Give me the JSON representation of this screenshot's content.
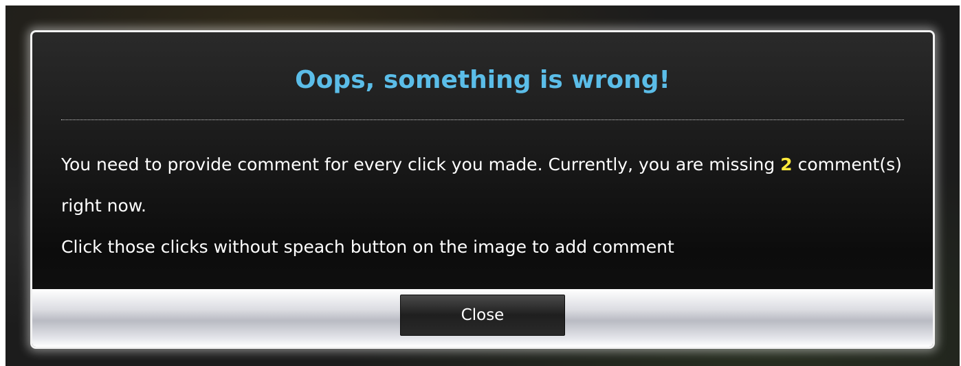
{
  "dialog": {
    "title": "Oops, something is wrong!",
    "message_part1": "You need to provide comment for every click you made. Currently, you are missing ",
    "missing_count": "2",
    "message_part2": " comment(s) right now.",
    "instruction": "Click those clicks without speach button on the image to add comment",
    "close_label": "Close"
  },
  "colors": {
    "title": "#5bbde8",
    "highlight": "#ffeb3b",
    "dialog_background": "#111111",
    "footer_background": "#d0d1d6"
  }
}
